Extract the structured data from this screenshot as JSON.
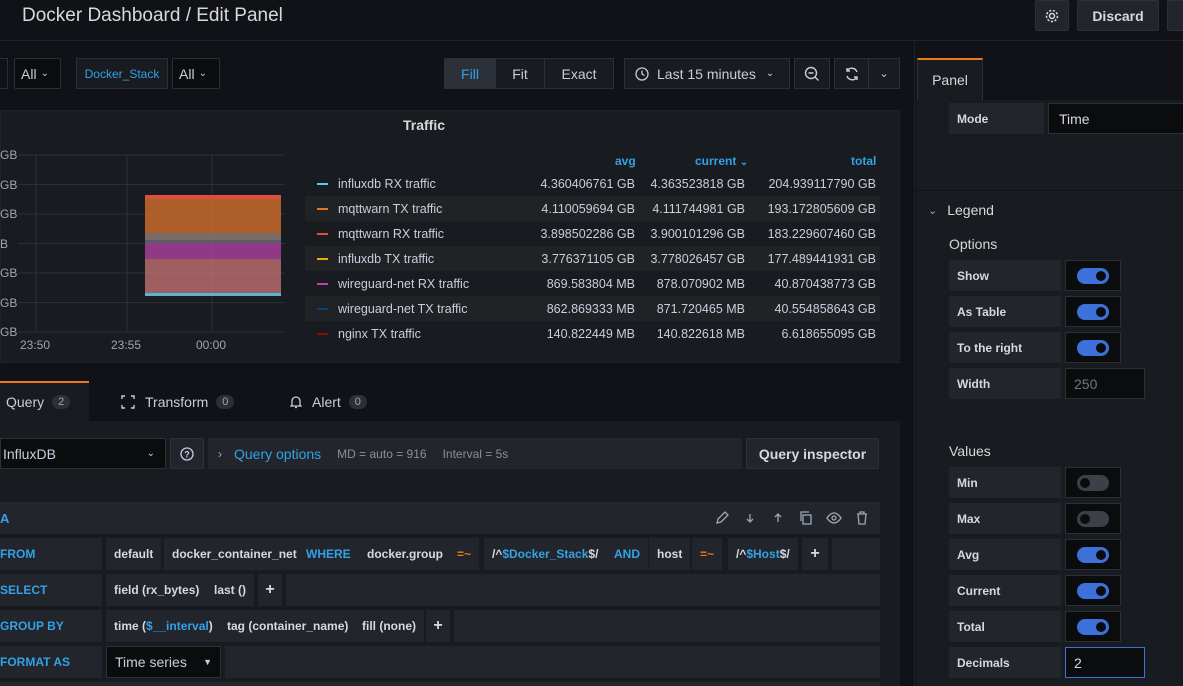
{
  "header": {
    "title": "Docker Dashboard / Edit Panel",
    "discard_label": "Discard"
  },
  "toolbar": {
    "var_all_1": "All",
    "var_name": "Docker_Stack",
    "var_all_2": "All",
    "fill": "Fill",
    "fit": "Fit",
    "exact": "Exact",
    "time_range": "Last 15 minutes"
  },
  "chart_data": {
    "type": "area",
    "title": "Traffic",
    "y_tick_labels": [
      "GB",
      "GB",
      "GB",
      "B",
      "GB",
      "GB",
      "GB"
    ],
    "x_tick_labels": [
      "23:50",
      "23:55",
      "00:00"
    ],
    "legend_headers": {
      "avg": "avg",
      "current": "current",
      "total": "total"
    },
    "series": [
      {
        "name": "influxdb RX traffic",
        "color": "#5ec6e8",
        "avg": "4.360406761 GB",
        "current": "4.363523818 GB",
        "total": "204.939117790 GB"
      },
      {
        "name": "mqttwarn TX traffic",
        "color": "#e0752d",
        "avg": "4.110059694 GB",
        "current": "4.111744981 GB",
        "total": "193.172805609 GB"
      },
      {
        "name": "mqttwarn RX traffic",
        "color": "#e24d42",
        "avg": "3.898502286 GB",
        "current": "3.900101296 GB",
        "total": "183.229607460 GB"
      },
      {
        "name": "influxdb TX traffic",
        "color": "#e5ac0e",
        "avg": "3.776371105 GB",
        "current": "3.778026457 GB",
        "total": "177.489441931 GB"
      },
      {
        "name": "wireguard-net RX traffic",
        "color": "#ba43a9",
        "avg": "869.583804 MB",
        "current": "878.070902 MB",
        "total": "40.870438773 GB"
      },
      {
        "name": "wireguard-net TX traffic",
        "color": "#0a437c",
        "avg": "862.869333 MB",
        "current": "871.720465 MB",
        "total": "40.554858643 GB"
      },
      {
        "name": "nginx TX traffic",
        "color": "#890f02",
        "avg": "140.822449 MB",
        "current": "140.822618 MB",
        "total": "6.618655095 GB"
      }
    ]
  },
  "query_tabs": [
    {
      "label": "Query",
      "count": "2"
    },
    {
      "label": "Transform",
      "count": "0"
    },
    {
      "label": "Alert",
      "count": "0"
    }
  ],
  "query": {
    "datasource": "InfluxDB",
    "options_label": "Query options",
    "md": "MD = auto = 916",
    "interval": "Interval = 5s",
    "inspector": "Query inspector",
    "ref_id": "A",
    "from_label": "FROM",
    "from": {
      "policy": "default",
      "measurement": "docker_container_net",
      "where": "WHERE",
      "key1": "docker.group",
      "op1": "=~",
      "val1_pre": "/^",
      "val1_var": "$Docker_Stack",
      "val1_post": "$/",
      "and": "AND",
      "key2": "host",
      "op2": "=~",
      "val2_pre": "/^",
      "val2_var": "$Host",
      "val2_post": "$/"
    },
    "select_label": "SELECT",
    "select": {
      "field": "field (rx_bytes)",
      "fn": "last ()"
    },
    "group_label": "GROUP BY",
    "group": {
      "time_pre": "time (",
      "time_var": "$__interval",
      "time_post": ")",
      "tag": "tag (container_name)",
      "fill": "fill (none)"
    },
    "format_label": "FORMAT AS",
    "format_value": "Time series"
  },
  "options": {
    "tab": "Panel",
    "mode_label": "Mode",
    "mode_value": "Time",
    "legend_section": "Legend",
    "options_heading": "Options",
    "show": "Show",
    "as_table": "As Table",
    "to_right": "To the right",
    "width": "Width",
    "width_placeholder": "250",
    "values_heading": "Values",
    "min": "Min",
    "max": "Max",
    "avg": "Avg",
    "current": "Current",
    "total": "Total",
    "decimals": "Decimals",
    "decimals_value": "2"
  }
}
